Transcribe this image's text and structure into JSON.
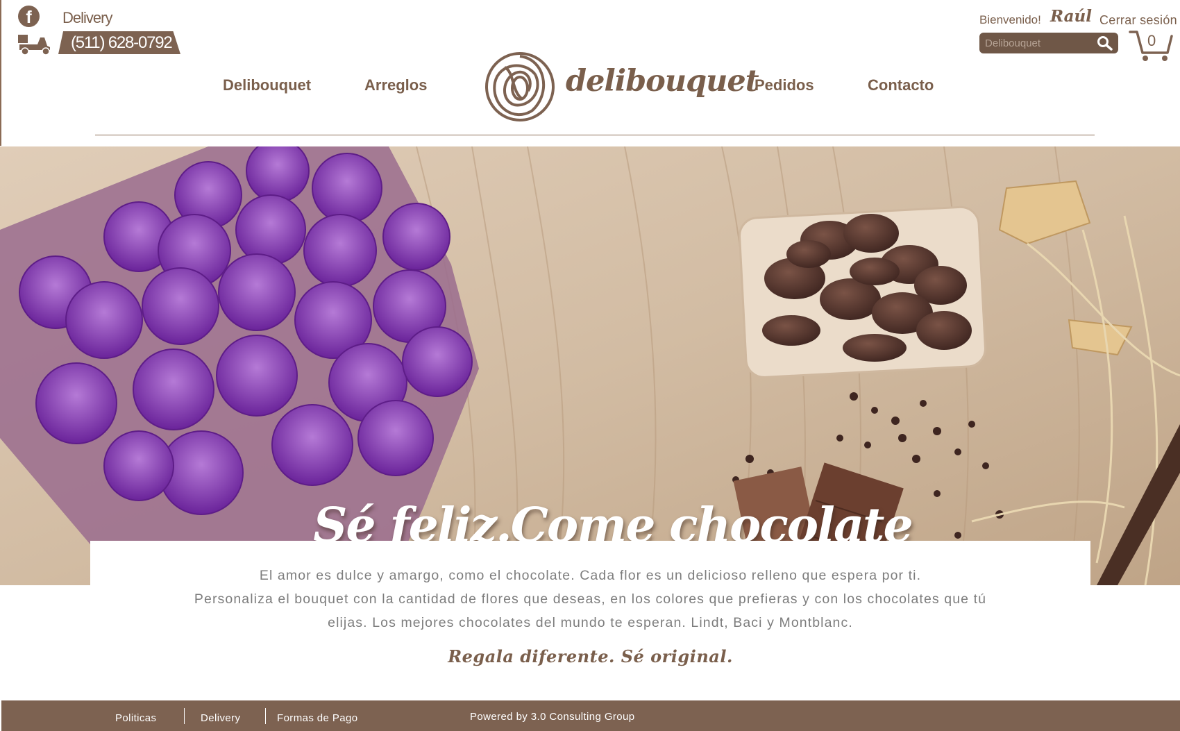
{
  "header": {
    "social_icon": "facebook-icon",
    "delivery_label": "Delivery",
    "delivery_icon": "scooter-icon",
    "phone": "(511) 628-0792",
    "welcome": "Bienvenido!",
    "user_name": "Raúl",
    "logout": "Cerrar sesión",
    "search_placeholder": "Delibouquet",
    "cart_count": "0",
    "nav": [
      "Delibouquet",
      "Arreglos",
      "Pedidos",
      "Contacto"
    ],
    "logo_text": "delibouquet"
  },
  "hero": {
    "title": "Sé feliz.Come chocolate"
  },
  "description": {
    "lines": [
      "El amor es dulce y amargo, como el chocolate. Cada flor es un delicioso relleno que espera por ti.",
      "Personaliza el bouquet con la cantidad de flores que deseas, en los colores que prefieras y con los chocolates que tú",
      "elijas. Los mejores chocolates del mundo te esperan. Lindt, Baci y Montblanc."
    ],
    "slogan": "Regala diferente. Sé original."
  },
  "footer": {
    "links": [
      "Politicas",
      "Delivery",
      "Formas de Pago"
    ],
    "powered": "Powered by 3.0 Consulting Group"
  },
  "colors": {
    "brand_brown": "#7d6251",
    "text_gray": "#7d7d7d",
    "background": "#ffffff"
  }
}
